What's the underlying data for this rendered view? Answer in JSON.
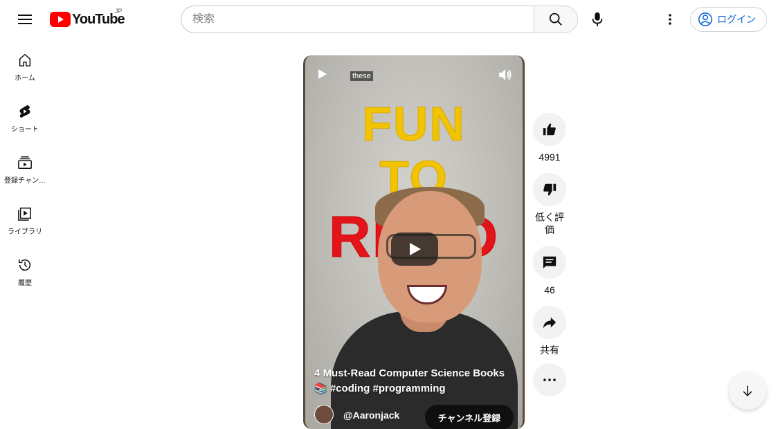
{
  "header": {
    "logo_text": "YouTube",
    "country_code": "JP",
    "search_placeholder": "検索",
    "login_label": "ログイン"
  },
  "sidebar": {
    "items": [
      {
        "label": "ホーム",
        "icon": "home-icon"
      },
      {
        "label": "ショート",
        "icon": "shorts-icon"
      },
      {
        "label": "登録チャン…",
        "icon": "subscriptions-icon"
      },
      {
        "label": "ライブラリ",
        "icon": "library-icon"
      },
      {
        "label": "履歴",
        "icon": "history-icon"
      }
    ]
  },
  "video": {
    "caption_word": "these",
    "overlay_lines": [
      "FUN",
      "TO",
      "READ"
    ],
    "title": "4 Must-Read Computer Science Books 📚 #coding #programming",
    "channel_name": "@Aaronjack",
    "subscribe_label": "チャンネル登録"
  },
  "actions": {
    "like_count": "4991",
    "dislike_label": "低く評価",
    "comment_count": "46",
    "share_label": "共有"
  },
  "colors": {
    "brand_red": "#ff0000",
    "link_blue": "#065fd4",
    "fun_yellow": "#f2c300",
    "read_red": "#e4141b"
  }
}
